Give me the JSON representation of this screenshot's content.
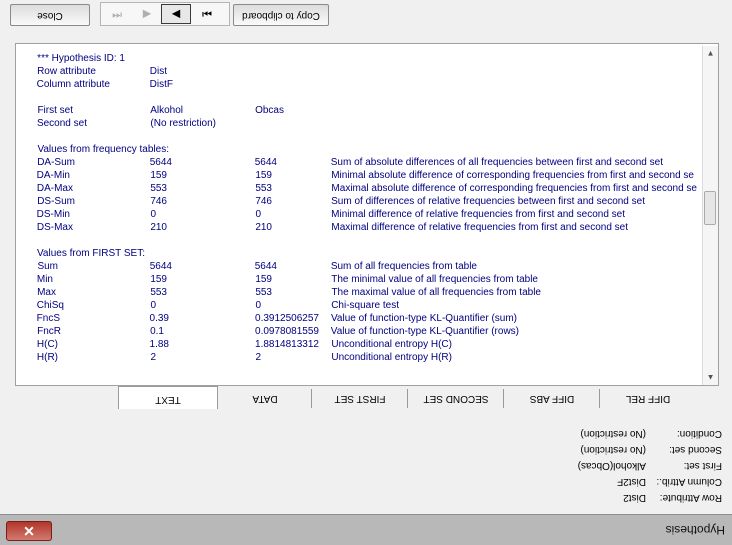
{
  "window": {
    "title": "Hypothesis",
    "close_glyph": "✕"
  },
  "conditions": [
    {
      "label": "Row Attribute:",
      "value": "Dist2"
    },
    {
      "label": "Column Attrib.:",
      "value": "Dist2F"
    },
    {
      "label": "First set:",
      "value": "Alkohol(Obcas)"
    },
    {
      "label": "Second set:",
      "value": "(No restriction)"
    },
    {
      "label": "Condition:",
      "value": "(No restriction)"
    }
  ],
  "tabs": [
    "TEXT",
    "DATA",
    "FIRST SET",
    "SECOND SET",
    "DIFF ABS",
    "DIFF REL"
  ],
  "active_tab": "TEXT",
  "text_lines": [
    [
      "*** Hypothesis ID: 1",
      "",
      "",
      ""
    ],
    [
      "Row attribute",
      "Dist",
      "",
      ""
    ],
    [
      "Column attribute",
      "DistF",
      "",
      ""
    ],
    [
      "",
      "",
      "",
      ""
    ],
    [
      "First set",
      "Alkohol",
      "Obcas",
      ""
    ],
    [
      "Second set",
      "(No restriction)",
      "",
      ""
    ],
    [
      "",
      "",
      "",
      ""
    ],
    [
      "Values from frequency tables:",
      "",
      "",
      ""
    ],
    [
      "DA-Sum",
      "5644",
      "5644",
      "Sum of absolute differences of all frequencies between first and second set"
    ],
    [
      "DA-Min",
      "159",
      "159",
      "Minimal absolute difference of corresponding frequencies from first and second se"
    ],
    [
      "DA-Max",
      "553",
      "553",
      "Maximal absolute difference of corresponding frequencies from first and second se"
    ],
    [
      "DS-Sum",
      "746",
      "746",
      "Sum of differences of relative frequencies between first and second set"
    ],
    [
      "DS-Min",
      "0",
      "0",
      "Minimal difference of relative frequencies from first and second set"
    ],
    [
      "DS-Max",
      "210",
      "210",
      "Maximal difference of relative frequencies from first and second set"
    ],
    [
      "",
      "",
      "",
      ""
    ],
    [
      "Values from FIRST SET:",
      "",
      "",
      ""
    ],
    [
      "Sum",
      "5644",
      "5644",
      "Sum of all frequencies from table"
    ],
    [
      "Min",
      "159",
      "159",
      "The minimal value of all frequencies from table"
    ],
    [
      "Max",
      "553",
      "553",
      "The maximal value of all frequencies from table"
    ],
    [
      "ChiSq",
      "0",
      "0",
      "Chi-square test"
    ],
    [
      "FncS",
      "0.39",
      "0.3912506257",
      "Value of function-type KL-Quantifier (sum)"
    ],
    [
      "FncR",
      "0.1",
      "0.0978081559",
      "Value of function-type KL-Quantifier (rows)"
    ],
    [
      "H(C)",
      "1.88",
      "1.8814813312",
      "Unconditional entropy H(C)"
    ],
    [
      "H(R)",
      "2",
      "2",
      "Unconditional entropy H(R)"
    ]
  ],
  "toolbar": {
    "close_label": "Close",
    "copy_label": "Copy to clipboard",
    "nav": [
      {
        "name": "first-record-button",
        "glyph": "⏮",
        "enabled": false
      },
      {
        "name": "prev-record-button",
        "glyph": "◀",
        "enabled": false
      },
      {
        "name": "next-record-button",
        "glyph": "▶",
        "enabled": true
      },
      {
        "name": "last-record-button",
        "glyph": "⏭",
        "enabled": true
      }
    ]
  }
}
